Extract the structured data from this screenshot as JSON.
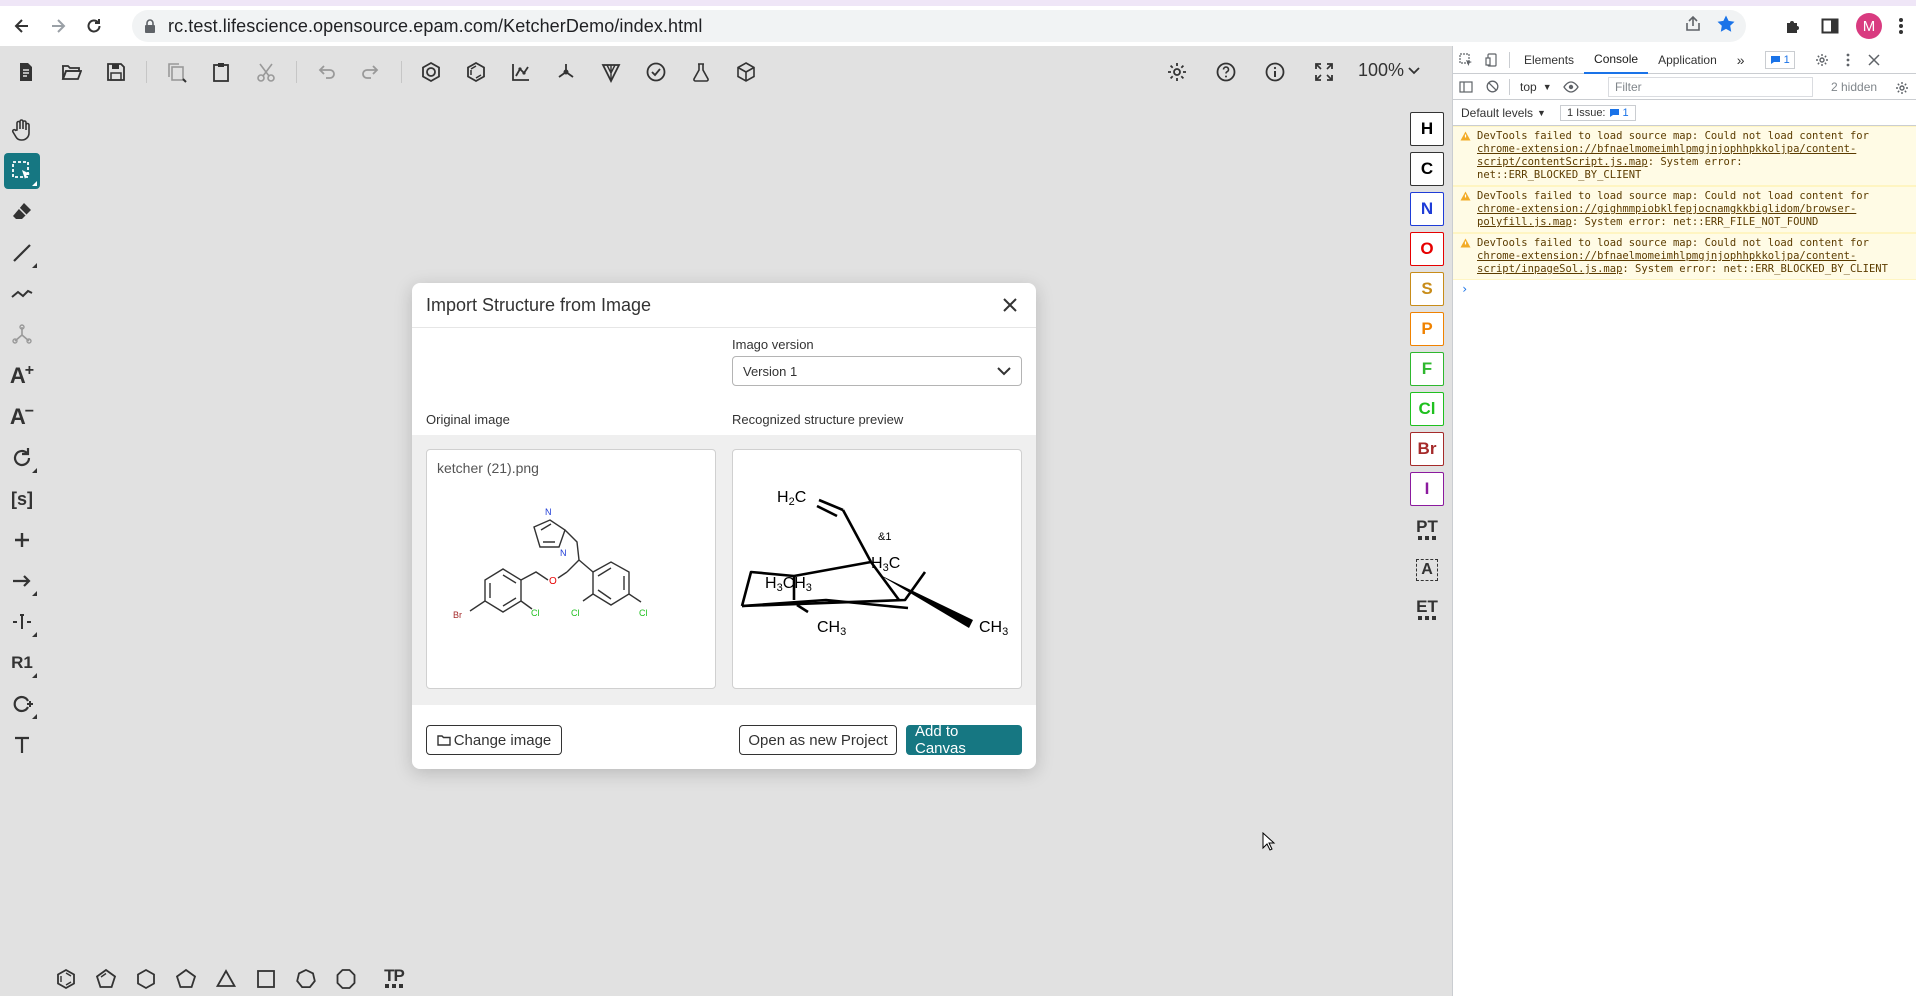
{
  "browser": {
    "url": "rc.test.lifescience.opensource.epam.com/KetcherDemo/index.html",
    "avatar_letter": "M"
  },
  "toolbar": {
    "zoom": "100%"
  },
  "left_toolbar": {
    "atom_text_add": "A",
    "atom_text_remove": "A",
    "sgroup": "[s]",
    "rgroup": "R1"
  },
  "atoms": [
    {
      "symbol": "H",
      "color": "#000000"
    },
    {
      "symbol": "C",
      "color": "#000000"
    },
    {
      "symbol": "N",
      "color": "#1e3cd7"
    },
    {
      "symbol": "O",
      "color": "#e60000"
    },
    {
      "symbol": "S",
      "color": "#c88c19"
    },
    {
      "symbol": "P",
      "color": "#f08200"
    },
    {
      "symbol": "F",
      "color": "#2eb82e"
    },
    {
      "symbol": "Cl",
      "color": "#1fc01f"
    },
    {
      "symbol": "Br",
      "color": "#a52a2a"
    },
    {
      "symbol": "I",
      "color": "#8b1a9e"
    }
  ],
  "right_toolbar": {
    "periodic_table": "PT",
    "any_atom": "A",
    "extended_table": "ET"
  },
  "bottom_toolbar": {
    "template_button": "TP"
  },
  "modal": {
    "title": "Import Structure from Image",
    "version_label": "Imago version",
    "version_value": "Version 1",
    "original_label": "Original image",
    "preview_label": "Recognized structure preview",
    "file_name": "ketcher (21).png",
    "change_image": "Change image",
    "open_new_project": "Open as new Project",
    "add_to_canvas": "Add to Canvas",
    "original_atoms": {
      "n1": "N",
      "n2": "N",
      "o": "O",
      "br": "Br",
      "cl1": "Cl",
      "cl2": "Cl",
      "cl3": "Cl"
    },
    "preview_labels": {
      "h2c": "H",
      "h2c_sub": "2",
      "h2c_c": "C",
      "stereo": "&1",
      "h3c_1": "H",
      "h3c_1_sub": "3",
      "h3c_1_c": "C",
      "h3c_2": "H",
      "h3c_2_sub": "3",
      "h3c_2_c": "CH",
      "h3c_2_c_sub": "3",
      "ch3_1": "CH",
      "ch3_1_sub": "3",
      "ch3_2": "CH",
      "ch3_2_sub": "3"
    }
  },
  "devtools": {
    "tabs": [
      "Elements",
      "Console",
      "Application"
    ],
    "more": "»",
    "issues_count": "1",
    "context": "top",
    "filter_placeholder": "Filter",
    "hidden": "2 hidden",
    "levels": "Default levels",
    "issue_label": "1 Issue:",
    "issue_count": "1",
    "warnings": [
      {
        "pre": "DevTools failed to load source map: Could not load content for ",
        "link": "chrome-extension://bfnaelmomeimhlpmgjnjophhpkkoljpa/content-script/contentScript.js.map",
        "post": ": System error: net::ERR_BLOCKED_BY_CLIENT"
      },
      {
        "pre": "DevTools failed to load source map: Could not load content for ",
        "link": "chrome-extension://gighmmpiobklfepjocnamgkkbiglidom/browser-polyfill.js.map",
        "post": ": System error: net::ERR_FILE_NOT_FOUND"
      },
      {
        "pre": "DevTools failed to load source map: Could not load content for ",
        "link": "chrome-extension://bfnaelmomeimhlpmgjnjophhpkkoljpa/content-script/inpageSol.js.map",
        "post": ": System error: net::ERR_BLOCKED_BY_CLIENT"
      }
    ],
    "prompt": "›"
  }
}
